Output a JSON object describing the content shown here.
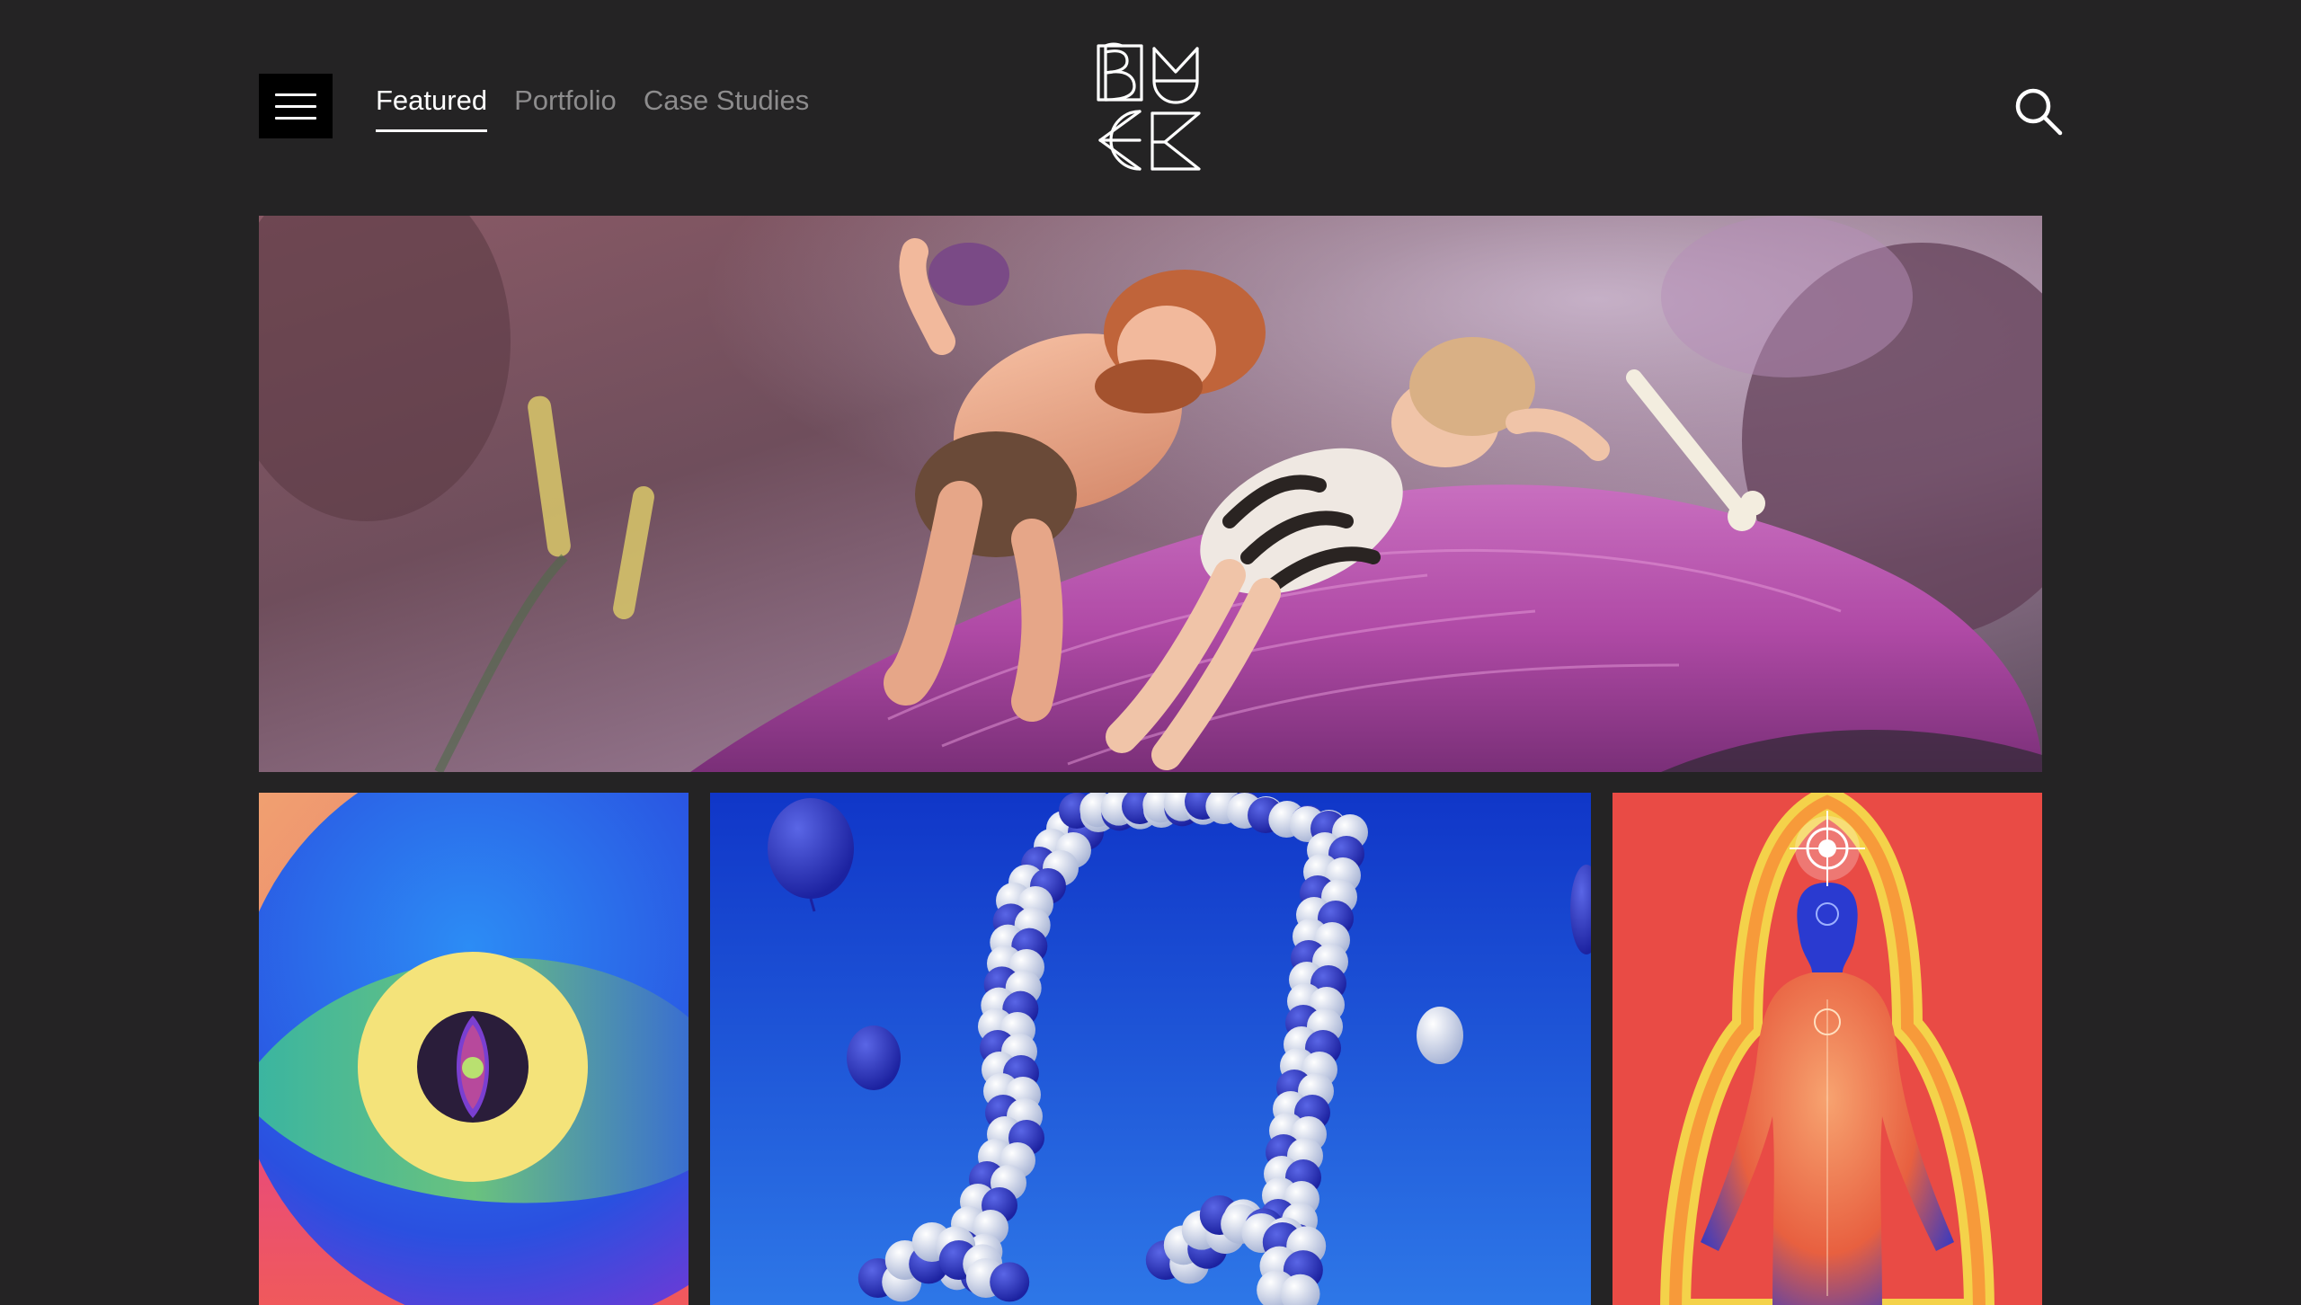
{
  "header": {
    "menu_icon": "hamburger-menu-icon",
    "logo_icon": "buck-geometric-logo",
    "search_icon": "search-icon",
    "nav": [
      {
        "label": "Featured",
        "active": true
      },
      {
        "label": "Portfolio",
        "active": false
      },
      {
        "label": "Case Studies",
        "active": false
      }
    ]
  },
  "colors": {
    "background": "#242324",
    "nav_active": "#ffffff",
    "nav_inactive": "#8d8c8d",
    "menu_button_bg": "#000000"
  },
  "tiles": {
    "hero": {
      "subject": "claymation-cave-couple-on-pink-furry-hill"
    },
    "grid": [
      {
        "subject": "stylized-eye-illustration"
      },
      {
        "subject": "balloon-music-note-on-blue"
      },
      {
        "subject": "glowing-human-figure-on-red"
      }
    ]
  }
}
